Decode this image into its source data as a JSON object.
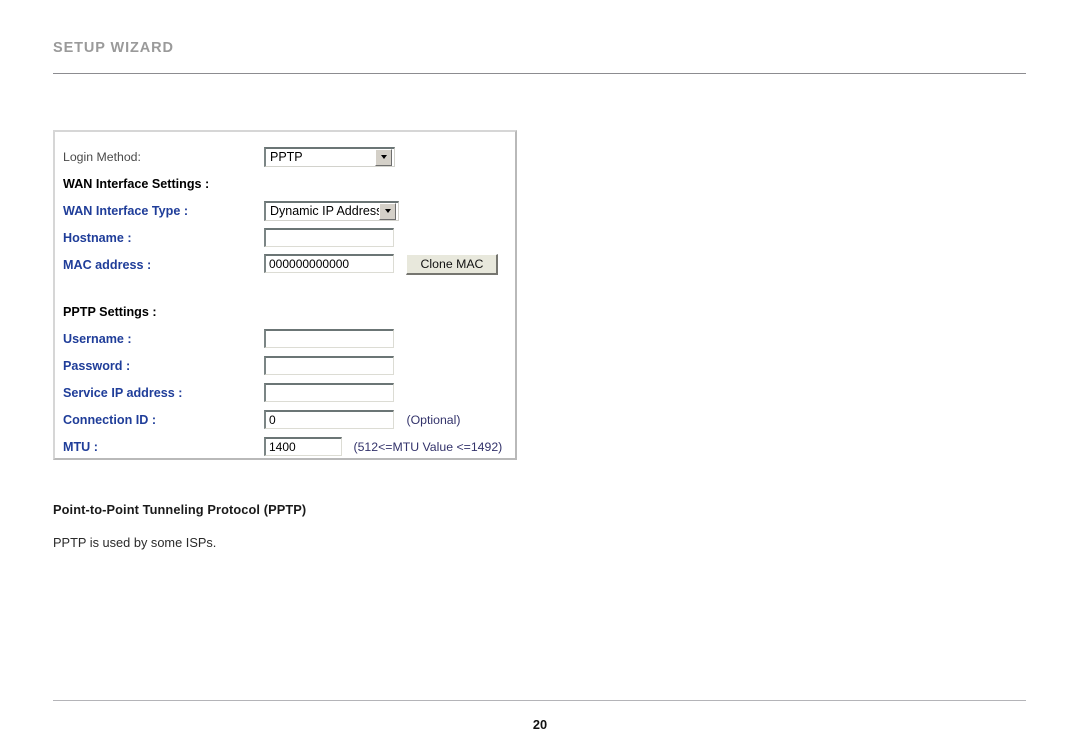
{
  "header": {
    "title": "SETUP WIZARD"
  },
  "form": {
    "rows": [
      {
        "label": "Login Method:",
        "style": "plain"
      },
      {
        "label": "WAN Interface Settings :",
        "style": "section"
      },
      {
        "label": "WAN Interface Type :",
        "style": "blue"
      },
      {
        "label": "Hostname :",
        "style": "blue"
      },
      {
        "label": "MAC address :",
        "style": "blue"
      },
      {
        "label": "PPTP Settings :",
        "style": "section"
      },
      {
        "label": "Username :",
        "style": "blue"
      },
      {
        "label": "Password :",
        "style": "blue"
      },
      {
        "label": "Service IP address :",
        "style": "blue"
      },
      {
        "label": "Connection ID :",
        "style": "blue"
      },
      {
        "label": "MTU :",
        "style": "blue"
      }
    ],
    "login_method": {
      "selected": "PPTP",
      "options": [
        "PPTP"
      ]
    },
    "wan_interface_type": {
      "selected": "Dynamic IP Address",
      "options": [
        "Dynamic IP Address"
      ]
    },
    "hostname": {
      "value": "",
      "placeholder": ""
    },
    "mac_address": {
      "value": "000000000000",
      "placeholder": ""
    },
    "clone_mac_button": "Clone MAC",
    "username": {
      "value": "",
      "placeholder": ""
    },
    "password": {
      "value": "",
      "placeholder": ""
    },
    "service_ip_address": {
      "value": "",
      "placeholder": ""
    },
    "connection_id": {
      "value": "0",
      "placeholder": ""
    },
    "connection_id_hint": "(Optional)",
    "mtu": {
      "value": "1400",
      "placeholder": ""
    },
    "mtu_hint": "(512<=MTU Value <=1492)"
  },
  "body": {
    "heading": "Point-to-Point Tunneling Protocol (PPTP)",
    "paragraph": "PPTP is used by some ISPs."
  },
  "footer": {
    "page_number": "20"
  },
  "colors": {
    "header_gray": "#9a9a9a",
    "label_blue": "#1f3d99",
    "label_black": "#000000",
    "button_face": "#e8e8dc"
  }
}
